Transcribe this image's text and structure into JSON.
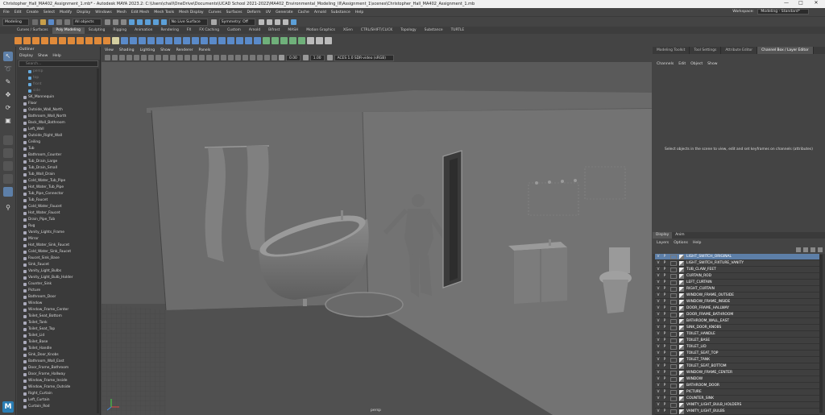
{
  "window": {
    "title": "Christopher_Hall_MA402_Assignment_1.mb* - Autodesk MAYA 2023.2: C:\\Users\\chall\\OneDrive\\Documents\\UCAD School 2021-2022\\MA402_Environmental_Modeling_III\\Assignment_1\\scenes\\Christopher_Hall_MA402_Assignment_1.mb",
    "minimize": "—",
    "maximize": "□",
    "close": "✕"
  },
  "menubar": {
    "items": [
      "File",
      "Edit",
      "Create",
      "Select",
      "Modify",
      "Display",
      "Windows",
      "Mesh",
      "Edit Mesh",
      "Mesh Tools",
      "Mesh Display",
      "Curves",
      "Surfaces",
      "Deform",
      "UV",
      "Generate",
      "Cache",
      "Arnold",
      "Substance",
      "Help"
    ],
    "workspace_label": "Workspace:",
    "workspace_value": "Modeling - Standard*"
  },
  "statusline": {
    "mode": "Modeling",
    "objects": "All objects",
    "live_surface": "No Live Surface",
    "symmetry": "Symmetry: Off"
  },
  "shelf": {
    "tabs": [
      "Curves / Surfaces",
      "Poly Modeling",
      "Sculpting",
      "Rigging",
      "Animation",
      "Rendering",
      "FX",
      "FX Caching",
      "Custom",
      "Arnold",
      "Bifrost",
      "MASH",
      "Motion Graphics",
      "XGen",
      "CTRL/SHIFT/CLICK",
      "Topology",
      "Substance",
      "TURTLE"
    ],
    "active": "Poly Modeling"
  },
  "outliner": {
    "title": "Outliner",
    "menu": [
      "Display",
      "Show",
      "Help"
    ],
    "search_placeholder": "Search...",
    "rows": [
      "persp",
      "top",
      "front",
      "side",
      "SK_Mannequin",
      "Floor",
      "Outside_Wall_North",
      "Bathroom_Wall_North",
      "Back_Wall_Bathroom",
      "Left_Wall",
      "Outside_Right_Wall",
      "Ceiling",
      "Tub",
      "Bathroom_Counter",
      "Tub_Drain_Large",
      "Tub_Drain_Small",
      "Tub_Wall_Drain",
      "Cold_Water_Tub_Pipe",
      "Hot_Water_Tub_Pipe",
      "Tub_Pipe_Connector",
      "Tub_Faucet",
      "Cold_Water_Faucet",
      "Hot_Water_Faucet",
      "Drain_Pipe_Tub",
      "Rug",
      "Vanity_Lights_Frame",
      "Mirror",
      "Hot_Water_Sink_Faucet",
      "Cold_Water_Sink_Faucet",
      "Faucet_Sink_Base",
      "Sink_Faucet",
      "Vanity_Light_Bulbs",
      "Vanity_Light_Bulb_Holder",
      "Counter_Sink",
      "Picture",
      "Bathroom_Door",
      "Window",
      "Window_Frame_Center",
      "Toilet_Seat_Bottom",
      "Toilet_Tank",
      "Toilet_Seat_Top",
      "Toilet_Lid",
      "Toilet_Base",
      "Toilet_Handle",
      "Sink_Door_Knobs",
      "Bathroom_Wall_East",
      "Door_Frame_Bathroom",
      "Door_Frame_Hallway",
      "Window_Frame_Inside",
      "Window_Frame_Outside",
      "Right_Curtain",
      "Left_Curtain",
      "Curtain_Rod"
    ]
  },
  "viewport": {
    "menu": [
      "View",
      "Shading",
      "Lighting",
      "Show",
      "Renderer",
      "Panels"
    ],
    "exposure": "0.00",
    "gamma": "1.00",
    "colorspace": "ACES 1.0 SDR-video (sRGB)",
    "camera_label": "persp"
  },
  "right_panel": {
    "tabs": [
      "Modeling Toolkit",
      "Tool Settings",
      "Attribute Editor",
      "Channel Box / Layer Editor"
    ],
    "active_tab": "Channel Box / Layer Editor",
    "cb_menu": [
      "Channels",
      "Edit",
      "Object",
      "Show"
    ],
    "cb_message": "Select objects in the scene to view, edit and set keyframes on channels (attributes)",
    "layer_tabs": [
      "Display",
      "Anim"
    ],
    "layer_menu": [
      "Layers",
      "Options",
      "Help"
    ],
    "layers": [
      "LIGHT_SWITCH_ORIGINAL",
      "LIGHT_SWITCH_FIXTURE_VANITY",
      "TUB_CLAW_FEET",
      "CURTAIN_ROD",
      "LEFT_CURTAIN",
      "RIGHT_CURTAIN",
      "WINDOW_FRAME_OUTSIDE",
      "WINDOW_FRAME_INSIDE",
      "DOOR_FRAME_HALLWAY",
      "DOOR_FRAME_BATHROOM",
      "BATHROOM_WALL_EAST",
      "SINK_DOOR_KNOBS",
      "TOILET_HANDLE",
      "TOILET_BASE",
      "TOILET_LID",
      "TOILET_SEAT_TOP",
      "TOILET_TANK",
      "TOILET_SEAT_BOTTOM",
      "WINDOW_FRAME_CENTER",
      "WINDOW",
      "BATHROOM_DOOR",
      "PICTURE",
      "COUNTER_SINK",
      "VANITY_LIGHT_BULB_HOLDERS",
      "VANITY_LIGHT_BULBS"
    ],
    "v_label": "V",
    "p_label": "P"
  },
  "toolbox_logo": "M",
  "colors": {
    "accent": "#5d7fa8",
    "maya_blue": "#2a7db4",
    "bg": "#444444"
  }
}
